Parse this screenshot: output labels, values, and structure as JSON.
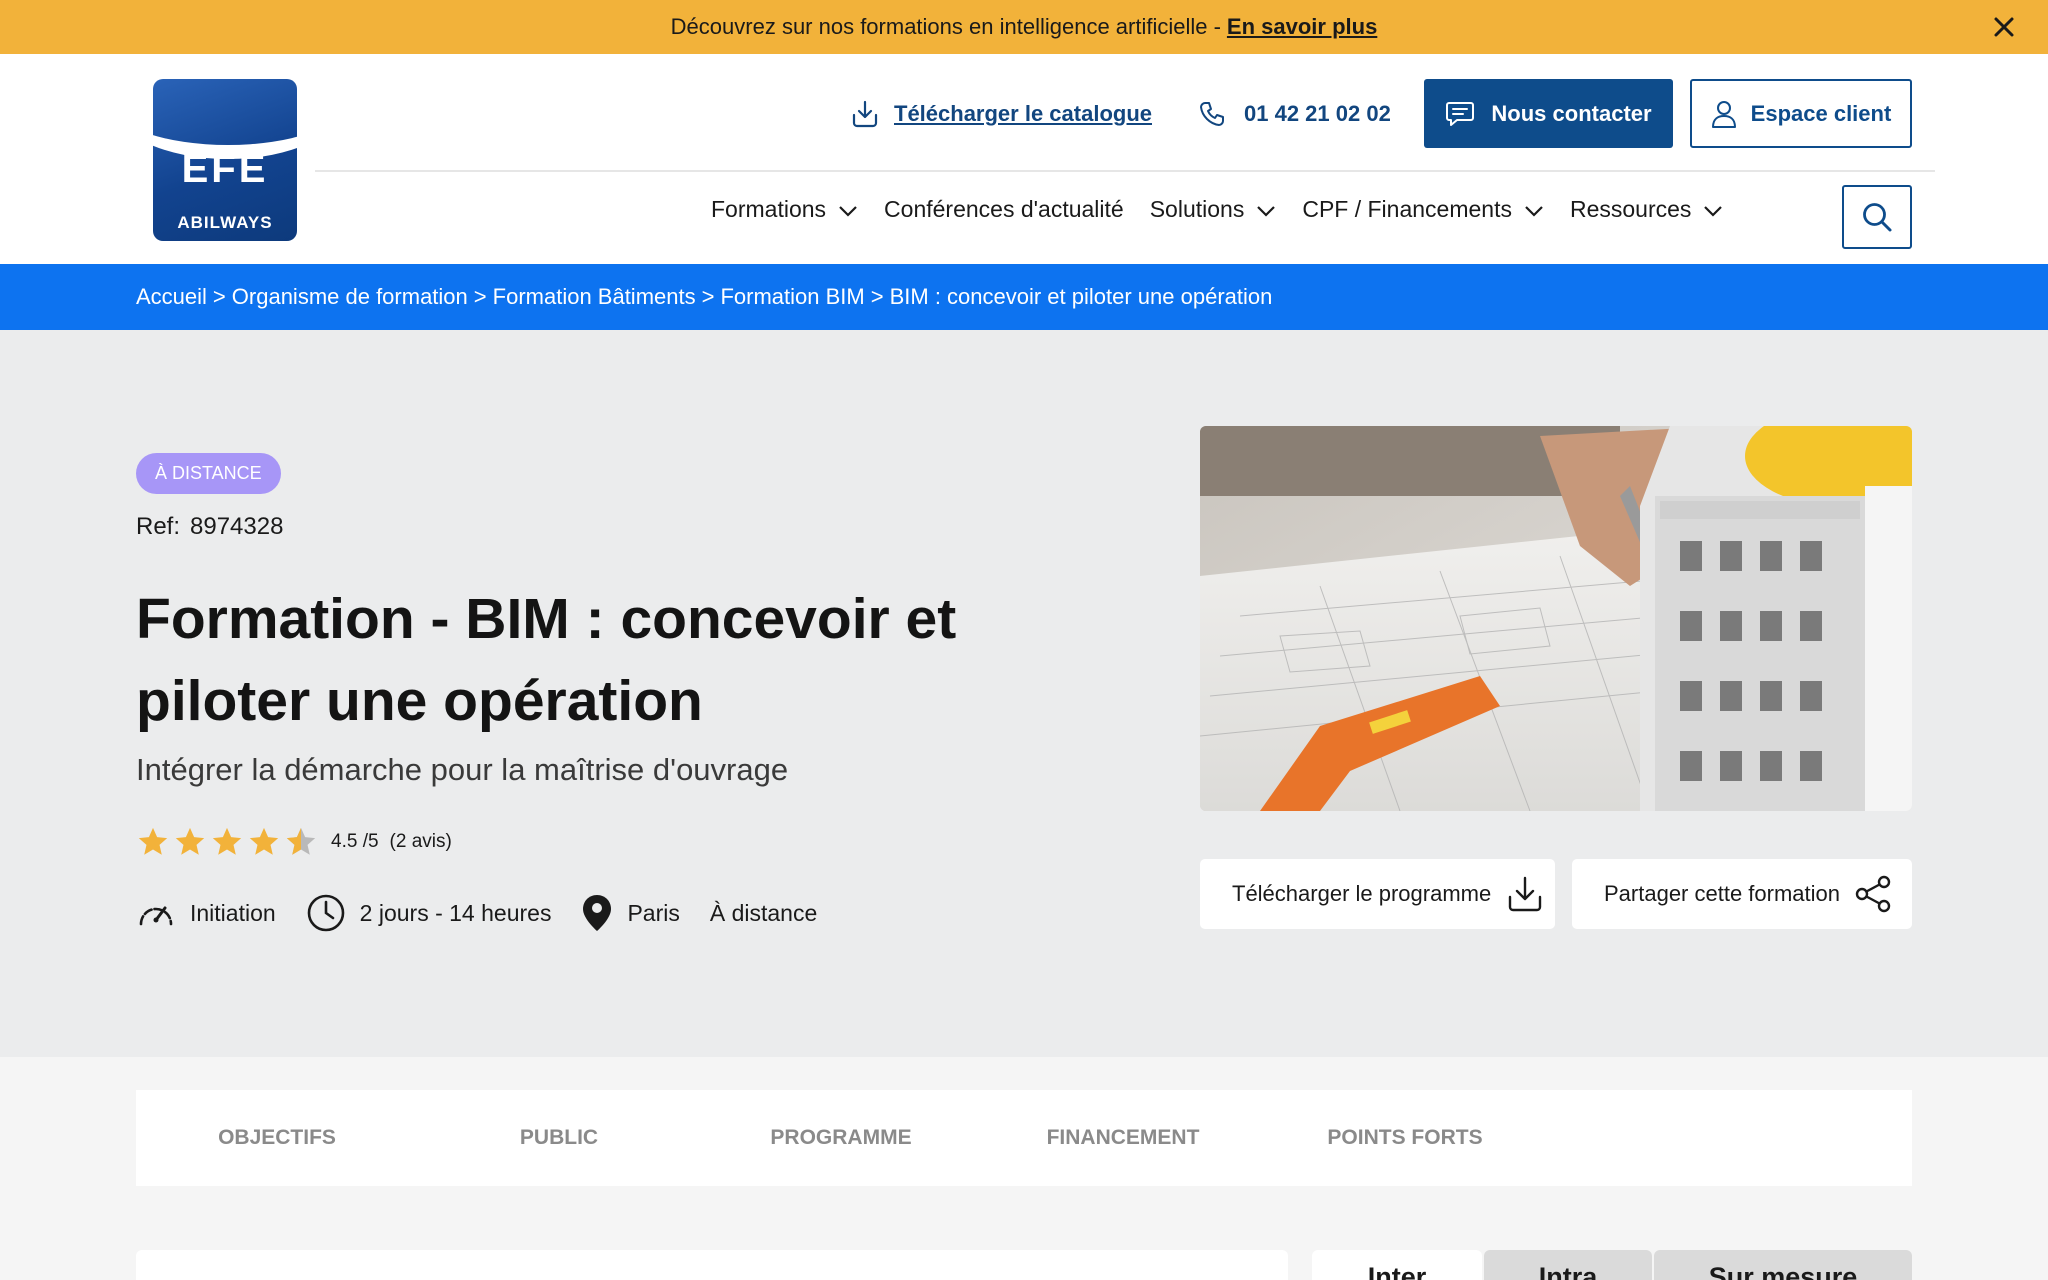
{
  "announcement": {
    "text": "Découvrez sur nos formations en intelligence artificielle -",
    "link": "En savoir plus"
  },
  "logo": {
    "top_text": "EFE",
    "bottom_text": "ABILWAYS"
  },
  "header": {
    "catalog_label": "Télécharger le catalogue",
    "phone": "01 42 21 02 02",
    "contact_label": "Nous contacter",
    "client_label": "Espace client"
  },
  "nav": [
    {
      "label": "Formations",
      "has_dropdown": true
    },
    {
      "label": "Conférences d'actualité",
      "has_dropdown": false
    },
    {
      "label": "Solutions",
      "has_dropdown": true
    },
    {
      "label": "CPF / Financements",
      "has_dropdown": true
    },
    {
      "label": "Ressources",
      "has_dropdown": true
    }
  ],
  "breadcrumb": [
    "Accueil",
    "Organisme de formation",
    "Formation Bâtiments",
    "Formation BIM",
    "BIM : concevoir et piloter une opération"
  ],
  "breadcrumb_separator": ">",
  "hero": {
    "badge": "À DISTANCE",
    "ref_label": "Ref:",
    "ref_value": "8974328",
    "title": "Formation - BIM : concevoir et piloter une opération",
    "subtitle": "Intégrer la démarche pour la maîtrise d'ouvrage",
    "rating_value": 4.5,
    "rating_text": "4.5 /5",
    "rating_count": "(2 avis)",
    "level": "Initiation",
    "duration": "2 jours - 14 heures",
    "location": "Paris",
    "location_mode": "À distance",
    "download_program": "Télécharger le programme",
    "share": "Partager cette formation"
  },
  "tabs": [
    "OBJECTIFS",
    "PUBLIC",
    "PROGRAMME",
    "FINANCEMENT",
    "POINTS FORTS"
  ],
  "format_tabs": [
    "Inter",
    "Intra",
    "Sur mesure"
  ],
  "colors": {
    "announcement_bg": "#f2b23a",
    "brand_blue": "#0e4c8b",
    "breadcrumb_bg": "#0d73f0",
    "badge_bg": "#a796f7",
    "star": "#f2b23a"
  }
}
